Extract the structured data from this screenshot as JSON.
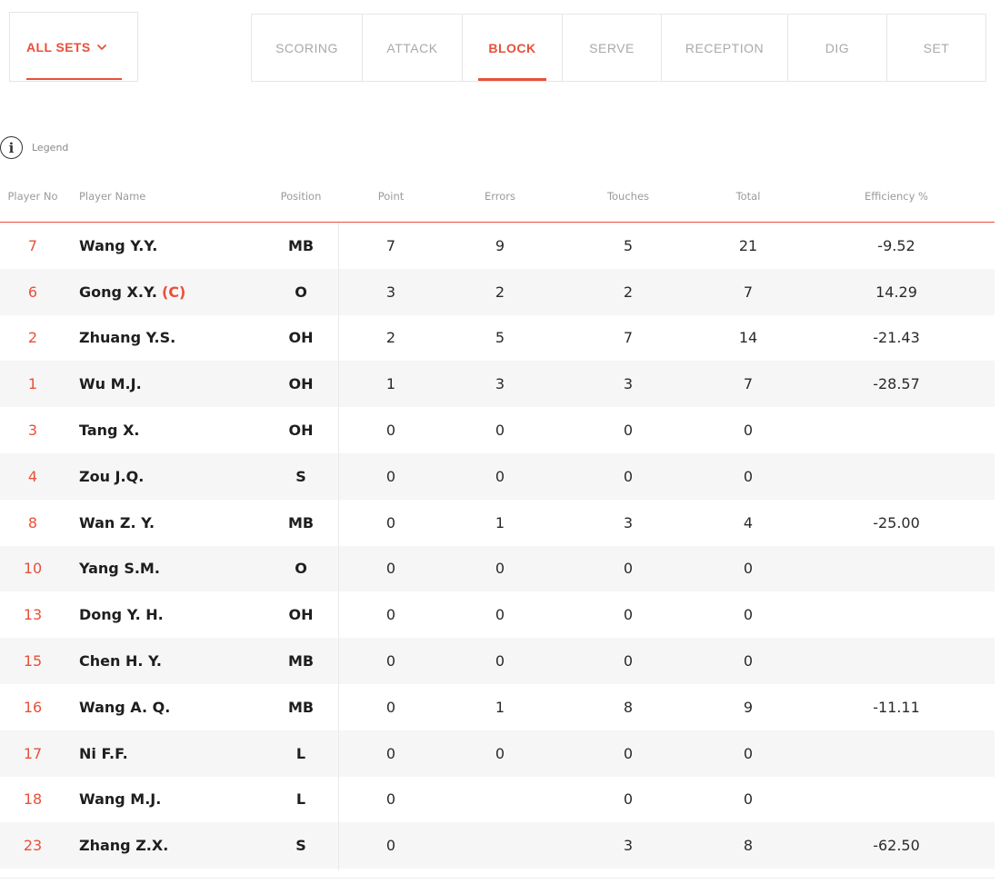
{
  "filter": {
    "sets_label": "ALL SETS"
  },
  "tabs": [
    {
      "label": "SCORING",
      "active": false
    },
    {
      "label": "ATTACK",
      "active": false
    },
    {
      "label": "BLOCK",
      "active": true
    },
    {
      "label": "SERVE",
      "active": false
    },
    {
      "label": "RECEPTION",
      "active": false
    },
    {
      "label": "DIG",
      "active": false
    },
    {
      "label": "SET",
      "active": false
    }
  ],
  "legend": {
    "icon": "info-icon",
    "label": "Legend"
  },
  "table": {
    "headers": {
      "player_no": "Player No",
      "player_name": "Player Name",
      "position": "Position",
      "point": "Point",
      "errors": "Errors",
      "touches": "Touches",
      "total": "Total",
      "efficiency": "Efficiency %"
    },
    "rows": [
      {
        "no": "7",
        "name": "Wang Y.Y.",
        "captain": "",
        "position": "MB",
        "point": "7",
        "errors": "9",
        "touches": "5",
        "total": "21",
        "efficiency": "-9.52"
      },
      {
        "no": "6",
        "name": "Gong X.Y.",
        "captain": "(C)",
        "position": "O",
        "point": "3",
        "errors": "2",
        "touches": "2",
        "total": "7",
        "efficiency": "14.29"
      },
      {
        "no": "2",
        "name": "Zhuang Y.S.",
        "captain": "",
        "position": "OH",
        "point": "2",
        "errors": "5",
        "touches": "7",
        "total": "14",
        "efficiency": "-21.43"
      },
      {
        "no": "1",
        "name": "Wu M.J.",
        "captain": "",
        "position": "OH",
        "point": "1",
        "errors": "3",
        "touches": "3",
        "total": "7",
        "efficiency": "-28.57"
      },
      {
        "no": "3",
        "name": "Tang X.",
        "captain": "",
        "position": "OH",
        "point": "0",
        "errors": "0",
        "touches": "0",
        "total": "0",
        "efficiency": ""
      },
      {
        "no": "4",
        "name": "Zou J.Q.",
        "captain": "",
        "position": "S",
        "point": "0",
        "errors": "0",
        "touches": "0",
        "total": "0",
        "efficiency": ""
      },
      {
        "no": "8",
        "name": "Wan Z. Y.",
        "captain": "",
        "position": "MB",
        "point": "0",
        "errors": "1",
        "touches": "3",
        "total": "4",
        "efficiency": "-25.00"
      },
      {
        "no": "10",
        "name": "Yang S.M.",
        "captain": "",
        "position": "O",
        "point": "0",
        "errors": "0",
        "touches": "0",
        "total": "0",
        "efficiency": ""
      },
      {
        "no": "13",
        "name": "Dong Y. H.",
        "captain": "",
        "position": "OH",
        "point": "0",
        "errors": "0",
        "touches": "0",
        "total": "0",
        "efficiency": ""
      },
      {
        "no": "15",
        "name": "Chen H. Y.",
        "captain": "",
        "position": "MB",
        "point": "0",
        "errors": "0",
        "touches": "0",
        "total": "0",
        "efficiency": ""
      },
      {
        "no": "16",
        "name": "Wang A. Q.",
        "captain": "",
        "position": "MB",
        "point": "0",
        "errors": "1",
        "touches": "8",
        "total": "9",
        "efficiency": "-11.11"
      },
      {
        "no": "17",
        "name": "Ni F.F.",
        "captain": "",
        "position": "L",
        "point": "0",
        "errors": "0",
        "touches": "0",
        "total": "0",
        "efficiency": ""
      },
      {
        "no": "18",
        "name": "Wang M.J.",
        "captain": "",
        "position": "L",
        "point": "0",
        "errors": "",
        "touches": "0",
        "total": "0",
        "efficiency": ""
      },
      {
        "no": "23",
        "name": "Zhang Z.X.",
        "captain": "",
        "position": "S",
        "point": "0",
        "errors": "",
        "touches": "3",
        "total": "8",
        "efficiency": "-62.50"
      }
    ]
  },
  "colors": {
    "accent": "#e8503a",
    "row_alt": "#f6f6f6",
    "border": "#e6e6e6"
  }
}
